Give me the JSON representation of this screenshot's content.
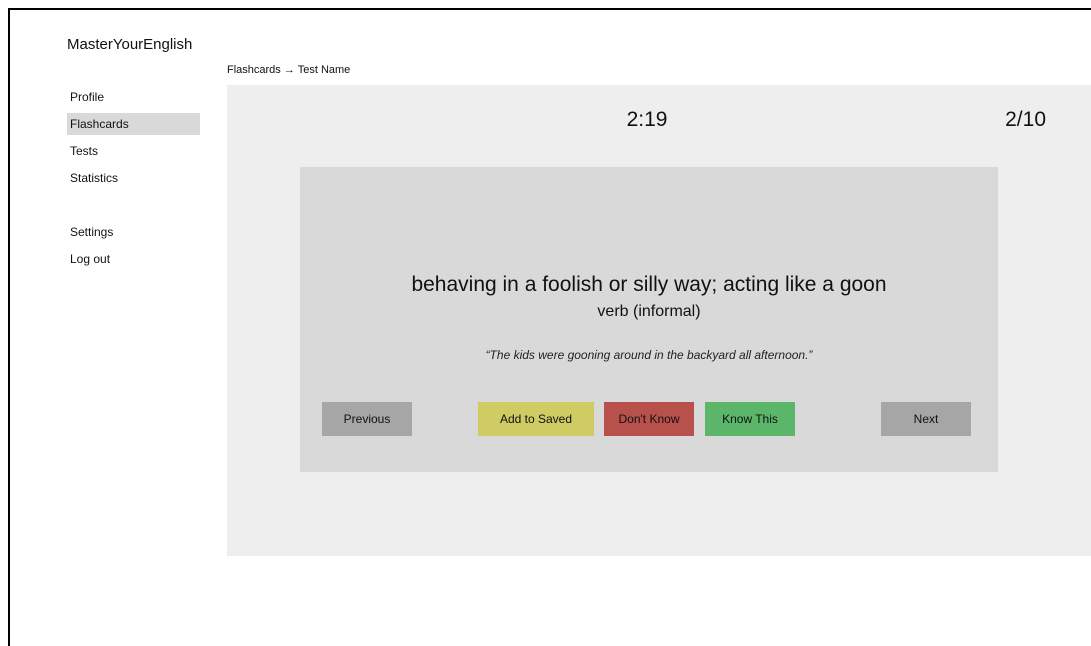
{
  "app": {
    "title": "MasterYourEnglish"
  },
  "breadcrumb": "Flashcards → Test Name",
  "sidebar": {
    "items": [
      {
        "label": "Profile"
      },
      {
        "label": "Flashcards"
      },
      {
        "label": "Tests"
      },
      {
        "label": "Statistics"
      },
      {
        "label": "Settings"
      },
      {
        "label": "Log out"
      }
    ],
    "active": "Flashcards"
  },
  "quiz": {
    "timer": "2:19",
    "progress": "2/10"
  },
  "card": {
    "definition": "behaving in a foolish or silly way; acting like a goon",
    "part_of_speech": "verb (informal)",
    "example": "“The kids were gooning around in the backyard all afternoon.”"
  },
  "buttons": {
    "previous": "Previous",
    "add_to_saved": "Add to Saved",
    "dont_know": "Don't Know",
    "know_this": "Know This",
    "next": "Next"
  },
  "colors": {
    "panel_bg": "#eeeeee",
    "card_bg": "#d9d9d9",
    "nav_button": "#a6a6a6",
    "save_button": "#cfcc64",
    "dont_know_button": "#b8504c",
    "know_this_button": "#5cb66a"
  }
}
